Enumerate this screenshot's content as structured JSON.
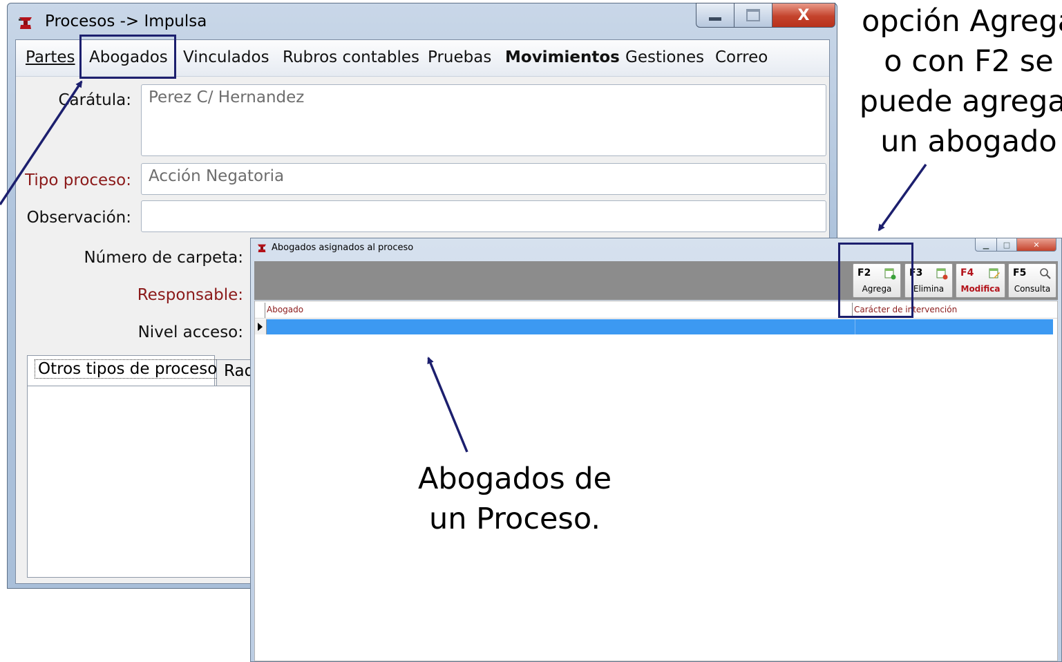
{
  "main_window": {
    "title": "Procesos -> Impulsa",
    "close_glyph": "X",
    "menu": [
      {
        "label": "Partes"
      },
      {
        "label": "Abogados"
      },
      {
        "label": "Vinculados"
      },
      {
        "label": "Rubros contables"
      },
      {
        "label": "Pruebas"
      },
      {
        "label": "Movimientos"
      },
      {
        "label": "Gestiones"
      },
      {
        "label": "Correo"
      }
    ],
    "fields": {
      "caratula_label": "Carátula:",
      "caratula_value": "Perez C/ Hernandez",
      "tipo_proceso_label": "Tipo proceso:",
      "tipo_proceso_value": "Acción Negatoria",
      "observacion_label": "Observación:",
      "observacion_value": "",
      "numero_carpeta_label": "Número de carpeta:",
      "responsable_label": "Responsable:",
      "nivel_acceso_label": "Nivel acceso:"
    },
    "tabs": [
      {
        "label": "Otros tipos de proceso"
      },
      {
        "label": "Radi"
      }
    ]
  },
  "dialog": {
    "title": "Abogados asignados al proceso",
    "toolbar": [
      {
        "key": "F2",
        "label": "Agrega"
      },
      {
        "key": "F3",
        "label": "Elimina"
      },
      {
        "key": "F4",
        "label": "Modifica"
      },
      {
        "key": "F5",
        "label": "Consulta"
      }
    ],
    "grid": {
      "columns": [
        "Abogado",
        "Carácter de intervención"
      ],
      "rows": []
    }
  },
  "annotations": {
    "top_callout": [
      "opción Agrega",
      "o con F2 se",
      "puede agregar",
      "un abogado"
    ],
    "center_callout": [
      "Abogados de",
      "un Proceso."
    ]
  },
  "colors": {
    "annotation": "#1c1f6e",
    "selected_row": "#3c99f2",
    "label_red": "#8b1a1a"
  }
}
